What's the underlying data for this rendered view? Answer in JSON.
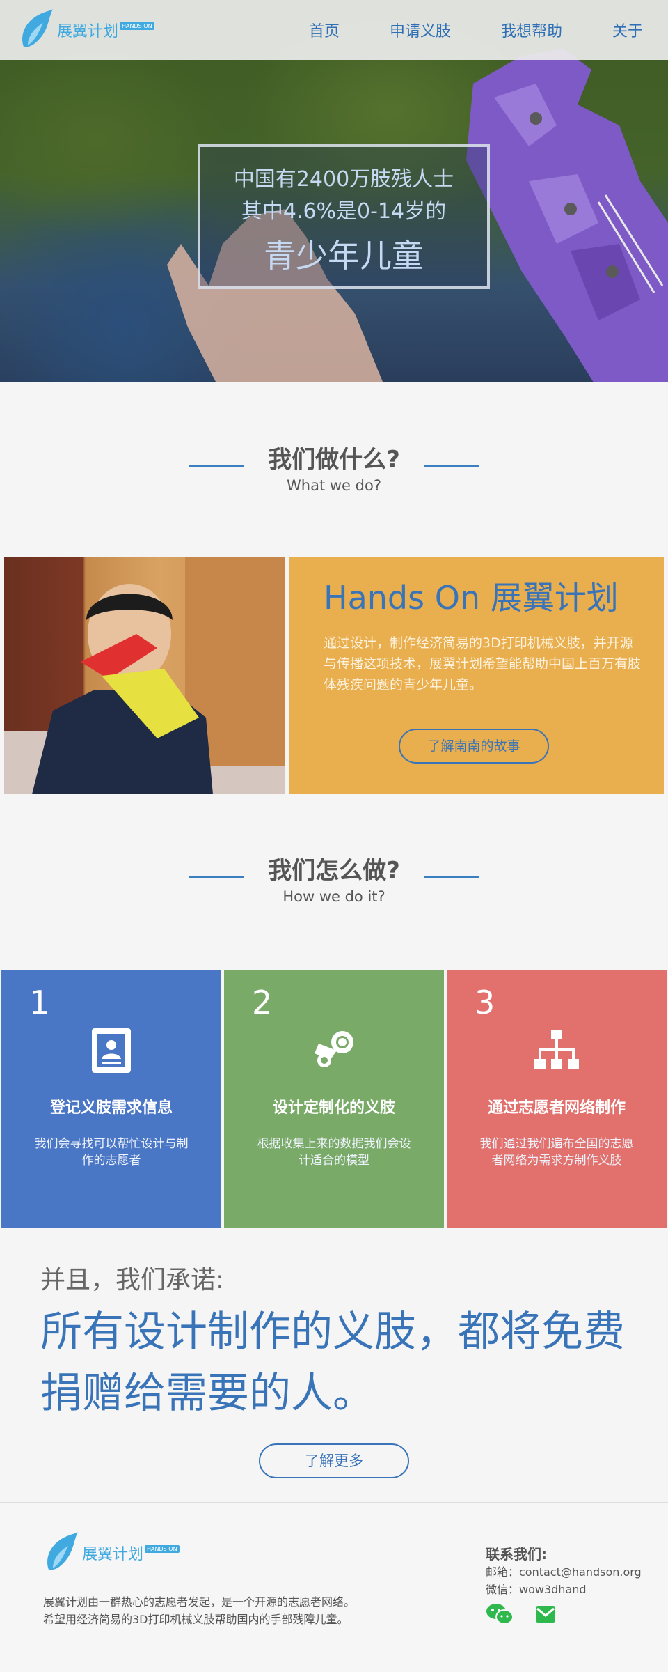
{
  "header": {
    "logo_text": "展翼计划",
    "logo_badge": "HANDS ON",
    "nav": [
      "首页",
      "申请义肢",
      "我想帮助",
      "关于"
    ]
  },
  "hero": {
    "line1": "中国有2400万肢残人士",
    "line2": "其中4.6%是0-14岁的",
    "line3": "青少年儿童"
  },
  "what": {
    "title": "我们做什么?",
    "subtitle": "What we do?",
    "story_title": "Hands On 展翼计划",
    "story_text": "通过设计，制作经济简易的3D打印机械义肢，并开源与传播这项技术，展翼计划希望能帮助中国上百万有肢体残疾问题的青少年儿童。",
    "story_button": "了解南南的故事"
  },
  "how": {
    "title": "我们怎么做?",
    "subtitle": "How we do it?",
    "steps": [
      {
        "num": "1",
        "icon": "id-card-icon",
        "title": "登记义肢需求信息",
        "desc": "我们会寻找可以帮忙设计与制作的志愿者",
        "color": "#4a76c6"
      },
      {
        "num": "2",
        "icon": "steam-icon",
        "title": "设计定制化的义肢",
        "desc": "根据收集上来的数据我们会设计适合的模型",
        "color": "#7aaa68"
      },
      {
        "num": "3",
        "icon": "sitemap-icon",
        "title": "通过志愿者网络制作",
        "desc": "我们通过我们遍布全国的志愿者网络为需求方制作义肢",
        "color": "#e2706d"
      }
    ]
  },
  "promise": {
    "lead": "并且，我们承诺:",
    "main": "所有设计制作的义肢，都将免费捐赠给需要的人。",
    "button": "了解更多"
  },
  "footer": {
    "logo_text": "展翼计划",
    "logo_badge": "HANDS ON",
    "desc_line1": "展翼计划由一群热心的志愿者发起，是一个开源的志愿者网络。",
    "desc_line2": "希望用经济简易的3D打印机械义肢帮助国内的手部残障儿童。",
    "contact_heading": "联系我们:",
    "email": "邮箱：contact@handson.org",
    "wechat": "微信：wow3dhand",
    "icons": [
      "wechat-icon",
      "mail-icon"
    ]
  },
  "colors": {
    "accent": "#3a74b8",
    "logo": "#3fa9e0",
    "story_bg": "#e9ae4d"
  }
}
